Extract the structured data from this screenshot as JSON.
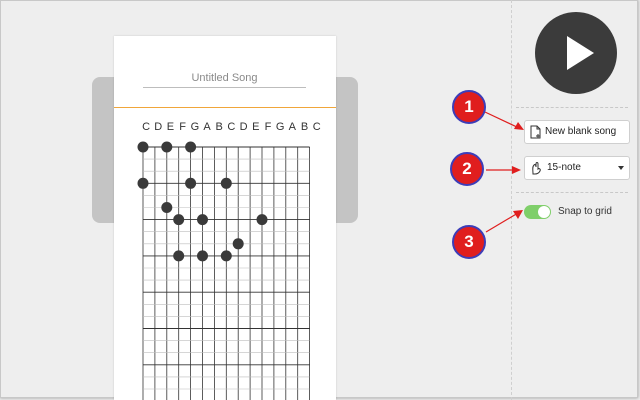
{
  "editor": {
    "song_title_placeholder": "Untitled Song",
    "note_names": [
      "C",
      "D",
      "E",
      "F",
      "G",
      "A",
      "B",
      "C",
      "D",
      "E",
      "F",
      "G",
      "A",
      "B",
      "C"
    ],
    "placed_notes": [
      {
        "col": 0,
        "row": 0
      },
      {
        "col": 2,
        "row": 0
      },
      {
        "col": 4,
        "row": 0
      },
      {
        "col": 0,
        "row": 3
      },
      {
        "col": 4,
        "row": 3
      },
      {
        "col": 7,
        "row": 3
      },
      {
        "col": 2,
        "row": 5
      },
      {
        "col": 3,
        "row": 6
      },
      {
        "col": 5,
        "row": 6
      },
      {
        "col": 10,
        "row": 6
      },
      {
        "col": 8,
        "row": 8
      },
      {
        "col": 3,
        "row": 9
      },
      {
        "col": 5,
        "row": 9
      },
      {
        "col": 7,
        "row": 9
      }
    ]
  },
  "sidebar": {
    "play_icon": "play-icon",
    "new_blank_song_label": "New blank song",
    "new_blank_song_icon": "new-document-icon",
    "note_count_value": "15-note",
    "note_count_icon": "music-hand-icon",
    "snap_to_grid_label": "Snap to grid",
    "snap_to_grid_on": true
  },
  "callouts": [
    {
      "number": "1"
    },
    {
      "number": "2"
    },
    {
      "number": "3"
    }
  ],
  "colors": {
    "accent_orange": "#f0a63a",
    "toggle_green": "#7fcf6a",
    "callout_red": "#e01e1e",
    "callout_border": "#3d3db8",
    "play_bg": "#3b3b3b"
  }
}
